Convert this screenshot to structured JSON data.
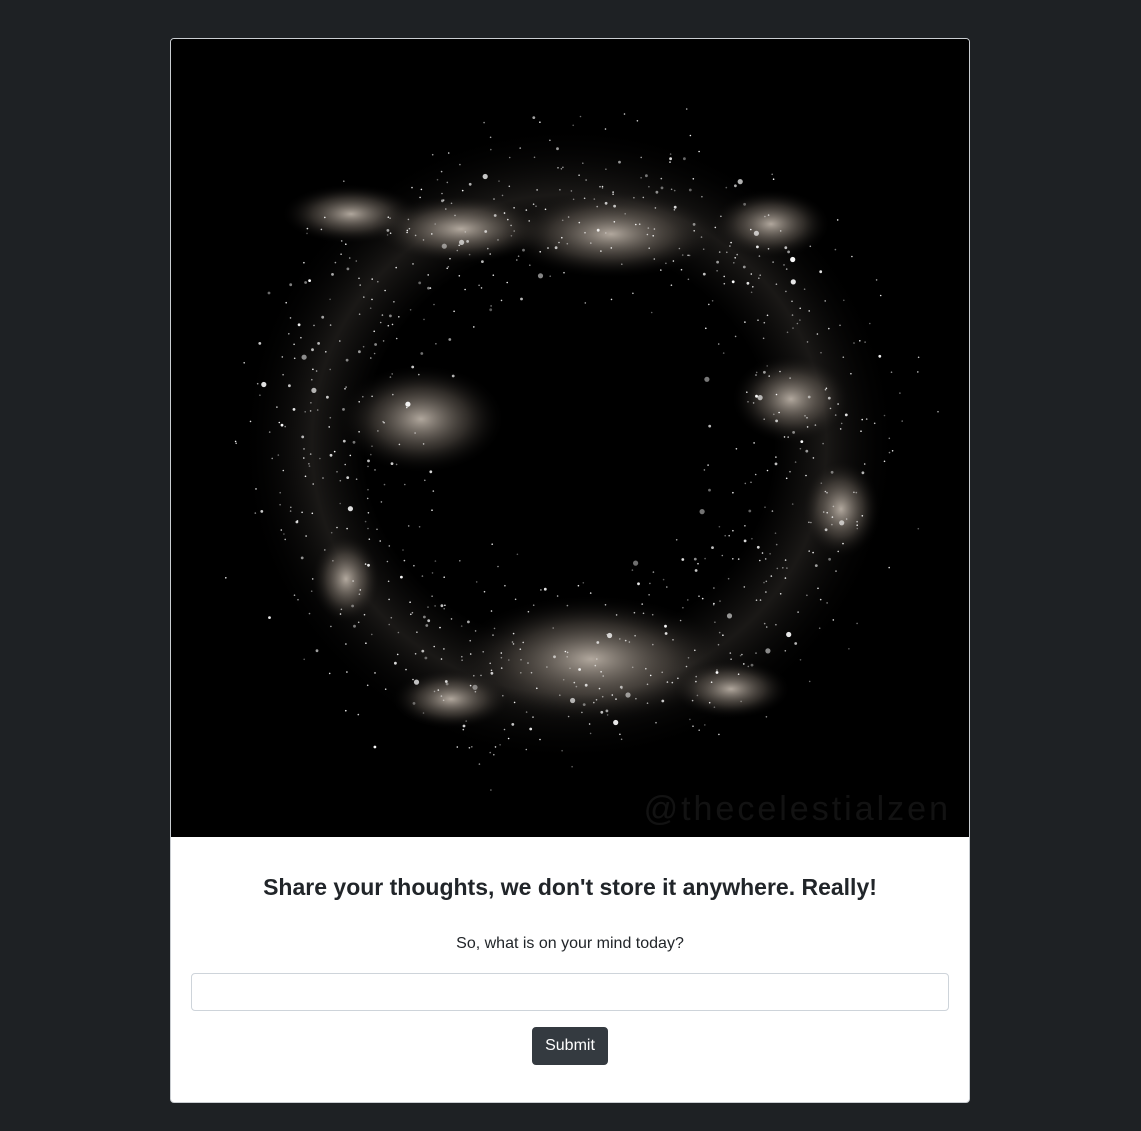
{
  "card": {
    "image": {
      "alt": "ring galaxy",
      "watermark": "@thecelestialzen"
    },
    "title": "Share your thoughts, we don't store it anywhere. Really!",
    "prompt": "So, what is on your mind today?",
    "input": {
      "value": "",
      "placeholder": ""
    },
    "submit_label": "Submit"
  },
  "colors": {
    "page_background": "#1e2124",
    "card_background": "#ffffff",
    "button_background": "#343a40",
    "text": "#212529"
  }
}
